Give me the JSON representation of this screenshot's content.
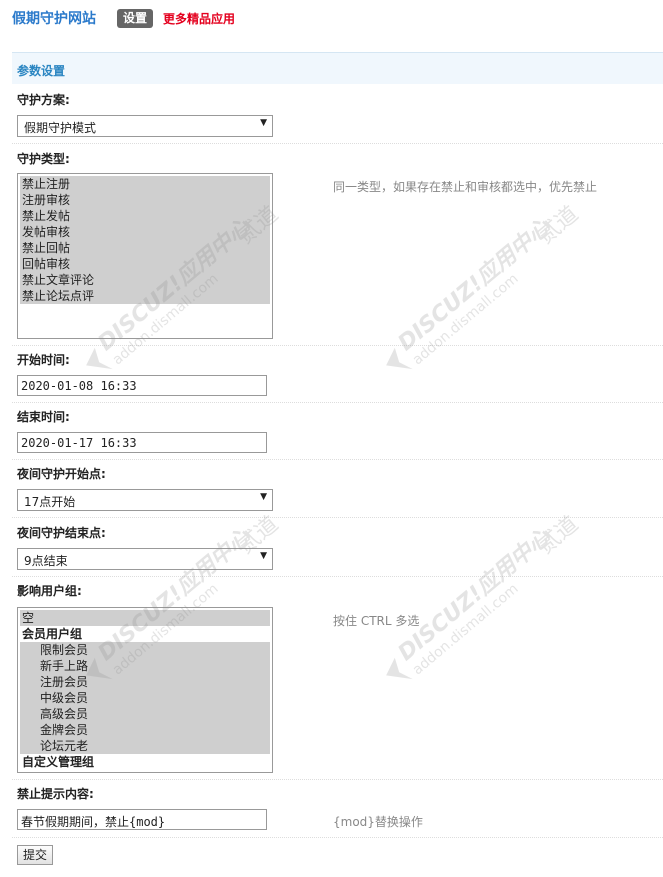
{
  "header": {
    "app_title": "假期守护网站",
    "tab_settings": "设置",
    "more_apps": "更多精品应用"
  },
  "section": {
    "title": "参数设置"
  },
  "form": {
    "scheme": {
      "label": "守护方案:",
      "value": "假期守护模式"
    },
    "types": {
      "label": "守护类型:",
      "options": [
        "禁止注册",
        "注册审核",
        "禁止发帖",
        "发帖审核",
        "禁止回帖",
        "回帖审核",
        "禁止文章评论",
        "禁止论坛点评"
      ],
      "tip": "同一类型，如果存在禁止和审核都选中，优先禁止"
    },
    "start_time": {
      "label": "开始时间:",
      "value": "2020-01-08 16:33"
    },
    "end_time": {
      "label": "结束时间:",
      "value": "2020-01-17 16:33"
    },
    "night_start": {
      "label": "夜间守护开始点:",
      "value": "17点开始"
    },
    "night_end": {
      "label": "夜间守护结束点:",
      "value": "9点结束"
    },
    "groups": {
      "label": "影响用户组:",
      "empty": "空",
      "member_group": "会员用户组",
      "members": [
        "限制会员",
        "新手上路",
        "注册会员",
        "中级会员",
        "高级会员",
        "金牌会员",
        "论坛元老"
      ],
      "custom_group": "自定义管理组",
      "tip": "按住 CTRL 多选"
    },
    "message": {
      "label": "禁止提示内容:",
      "value": "春节假期期间，禁止{mod}",
      "tip": "{mod}替换操作"
    },
    "submit_label": "提交"
  },
  "watermark": {
    "line1": "DISCUZ!应用中心",
    "line2": "addon.dismall.com",
    "mark": "贰道"
  }
}
